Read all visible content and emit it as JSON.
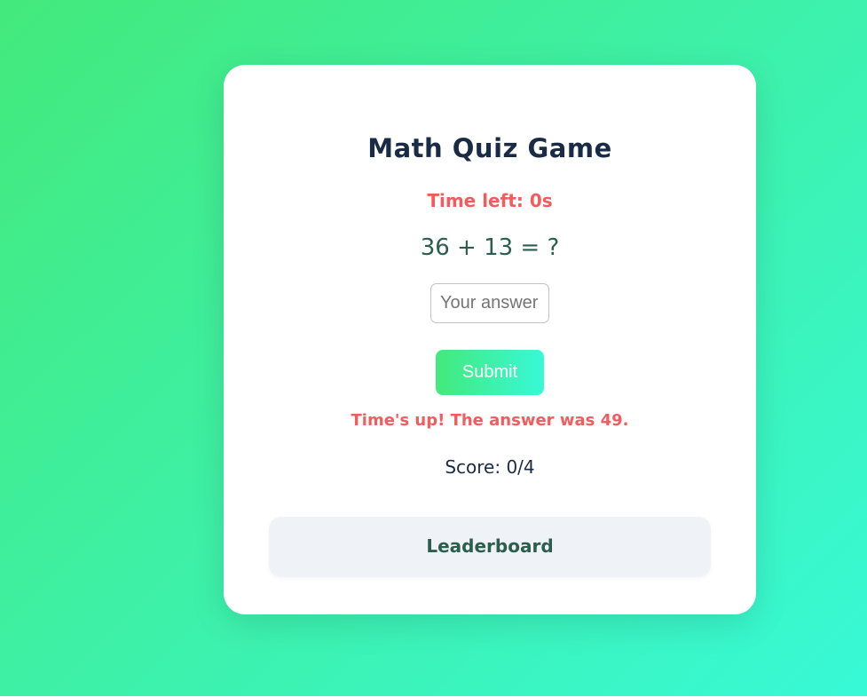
{
  "quiz": {
    "title": "Math Quiz Game",
    "timer_text": "Time left: 0s",
    "question": "36 + 13 = ?",
    "answer_input": {
      "value": "",
      "placeholder": "Your answer"
    },
    "submit_label": "Submit",
    "feedback": "Time's up! The answer was 49.",
    "score_text": "Score: 0/4"
  },
  "leaderboard": {
    "title": "Leaderboard"
  },
  "colors": {
    "background_start": "#43e97b",
    "background_end": "#38f9d7",
    "title": "#1a2b45",
    "alert": "#f25c5c",
    "question": "#2c5e4e",
    "panel": "#eff2f6"
  }
}
